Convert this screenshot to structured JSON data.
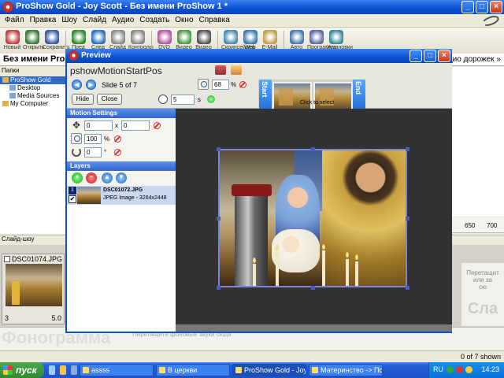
{
  "main": {
    "title": "ProShow Gold - Joy Scott - Без имени ProShow 1 *",
    "menu": [
      "Файл",
      "Правка",
      "Шоу",
      "Слайд",
      "Аудио",
      "Создать",
      "Окно",
      "Справка"
    ],
    "toolbar": [
      {
        "label": "Новый",
        "icon": "new-icon",
        "color": "#c04040"
      },
      {
        "label": "Открыть",
        "icon": "open-icon",
        "color": "#3a7a3a"
      },
      {
        "label": "Сохранить",
        "icon": "save-icon",
        "color": "#3a5aa0"
      },
      {
        "label": "Пред",
        "icon": "prev-icon",
        "color": "#2e8b2e"
      },
      {
        "label": "След",
        "icon": "next-icon",
        "color": "#2e6fc0"
      },
      {
        "label": "Слайд",
        "icon": "slide-icon",
        "color": "#8a8a8a"
      },
      {
        "label": "Контролы",
        "icon": "controls-icon",
        "color": "#888"
      },
      {
        "label": "DVD Диск",
        "icon": "dvd-icon",
        "color": "#b05aa0"
      },
      {
        "label": "Видео CD",
        "icon": "vcd-icon",
        "color": "#4a9a4a"
      },
      {
        "label": "Видео",
        "icon": "video-icon",
        "color": "#555"
      },
      {
        "label": "Скринсейвер",
        "icon": "screensaver-icon",
        "color": "#4a8ab0"
      },
      {
        "label": "Web Шоу",
        "icon": "web-show-icon",
        "color": "#3a7ab0"
      },
      {
        "label": "E-Mail",
        "icon": "email-icon",
        "color": "#c0a050"
      },
      {
        "label": "Авто CD",
        "icon": "autorun-cd-icon",
        "color": "#4a7ab0"
      },
      {
        "label": "Программа",
        "icon": "program-icon",
        "color": "#5a6aa0"
      },
      {
        "label": "Установки",
        "icon": "settings-icon",
        "color": "#3a8a9a"
      }
    ],
    "project_title": "Без имени ProS",
    "project_right": "аудио дорожек »",
    "folders_label": "Папки",
    "tree": [
      {
        "label": "ProShow Gold",
        "selected": true,
        "indent": 0
      },
      {
        "label": "Desktop",
        "selected": false,
        "indent": 1
      },
      {
        "label": "Media Sources",
        "selected": false,
        "indent": 1
      },
      {
        "label": "My Computer",
        "selected": false,
        "indent": 0
      }
    ],
    "ruler": {
      "t1": "650",
      "t2": "700"
    },
    "slideshow_label": "Слайд-шоу",
    "slide_card": {
      "filename": "DSC01074.JPG",
      "number": "3",
      "duration": "5.0"
    },
    "drop_hint": {
      "line1": "Перетащит",
      "line2": "или за",
      "line3": "сю",
      "big": "Сла"
    },
    "sound_big": "Фонограмма",
    "sound_hint": "Перетащите фоновые звуки сюда",
    "status": "0 of 7 shown"
  },
  "preview": {
    "title": "Preview",
    "name": "pshowMotionStartPos",
    "slide_counter": "Slide 5 of 7",
    "hide_label": "Hide",
    "close_label": "Close",
    "zoom_value": "68",
    "zoom_unit": "%",
    "duration_value": "5",
    "duration_unit": "s",
    "tl_start": "Start",
    "tl_end": "End",
    "tl_hint": "Click to select",
    "motion_header": "Motion Settings",
    "pos_x": "0",
    "pos_sep": "x",
    "pos_y": "0",
    "layer_zoom": "100",
    "layer_zoom_unit": "%",
    "rotation": "0",
    "rotation_unit": "°",
    "layers_header": "Layers",
    "layer": {
      "number": "1",
      "name": "DSC01072.JPG",
      "info": "JPEG Image - 3264x2448",
      "checked": "✔"
    }
  },
  "taskbar": {
    "start": "пуск",
    "tasks": [
      "assss",
      "В церкви",
      "ProShow Gold - Joy S...",
      "Материнство -> Пом..."
    ],
    "active_task": 2,
    "lang": "RU",
    "clock": "14:23"
  }
}
